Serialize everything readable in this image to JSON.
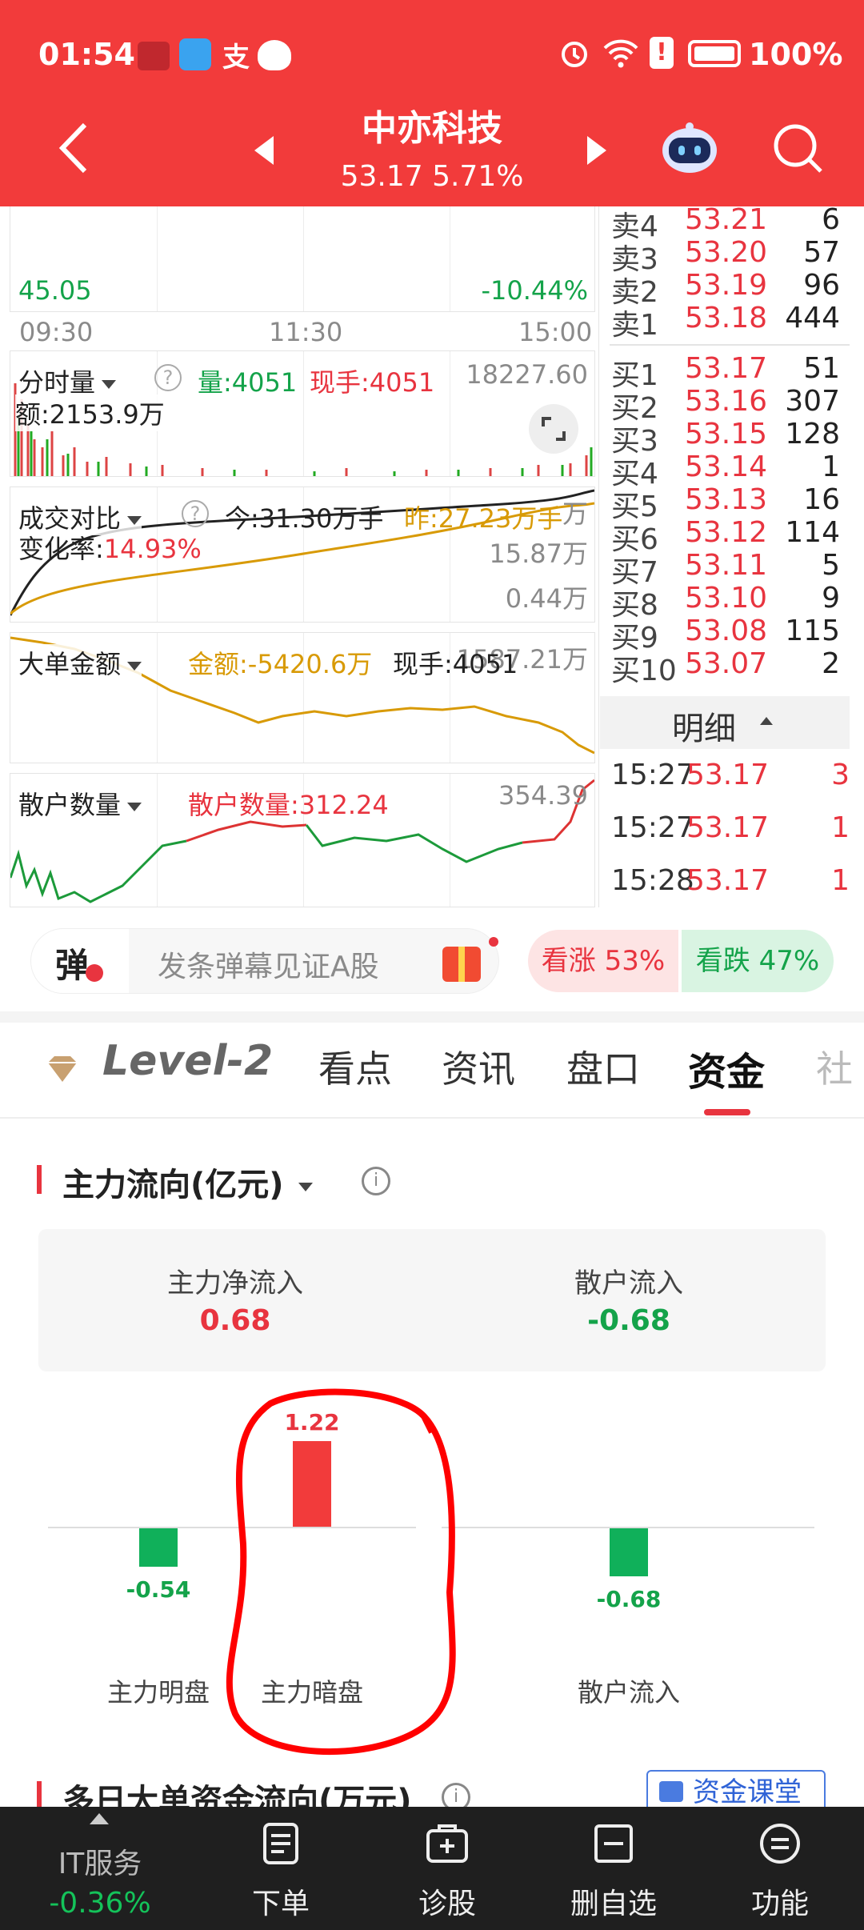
{
  "status_bar": {
    "time": "01:54",
    "battery": "100%"
  },
  "header": {
    "title": "中亦科技",
    "price_line": "53.17  5.71%"
  },
  "price_chart": {
    "low_price": "45.05",
    "low_pct": "-10.44%",
    "times": [
      "09:30",
      "11:30",
      "15:00"
    ]
  },
  "volume_panel": {
    "tab": "分时量",
    "vol": "量:4051",
    "hand": "现手:4051",
    "max": "18227.60",
    "amount": "额:2153.9万"
  },
  "compare_panel": {
    "tab": "成交对比",
    "today": "今:31.30万手",
    "yesterday": "昨:27.23万手",
    "turnover_label": "变化率:",
    "turnover_value": "14.93%",
    "axis_top": "万",
    "axis_mid": "15.87万",
    "axis_low": "0.44万"
  },
  "bigorder_panel": {
    "tab": "大单金额",
    "amount": "金额:-5420.6万",
    "hand": "现手:4051",
    "axis": "1587.21万"
  },
  "retail_panel": {
    "tab": "散户数量",
    "count": "散户数量:312.24",
    "axis": "354.39"
  },
  "order_book": {
    "asks": [
      {
        "label": "卖4",
        "price": "53.21",
        "vol": "6"
      },
      {
        "label": "卖3",
        "price": "53.20",
        "vol": "57"
      },
      {
        "label": "卖2",
        "price": "53.19",
        "vol": "96"
      },
      {
        "label": "卖1",
        "price": "53.18",
        "vol": "444"
      }
    ],
    "bids": [
      {
        "label": "买1",
        "price": "53.17",
        "vol": "51"
      },
      {
        "label": "买2",
        "price": "53.16",
        "vol": "307"
      },
      {
        "label": "买3",
        "price": "53.15",
        "vol": "128"
      },
      {
        "label": "买4",
        "price": "53.14",
        "vol": "1"
      },
      {
        "label": "买5",
        "price": "53.13",
        "vol": "16"
      },
      {
        "label": "买6",
        "price": "53.12",
        "vol": "114"
      },
      {
        "label": "买7",
        "price": "53.11",
        "vol": "5"
      },
      {
        "label": "买8",
        "price": "53.10",
        "vol": "9"
      },
      {
        "label": "买9",
        "price": "53.08",
        "vol": "115"
      },
      {
        "label": "买10",
        "price": "53.07",
        "vol": "2"
      }
    ],
    "detail_label": "明细",
    "trades": [
      {
        "time": "15:27",
        "price": "53.17",
        "vol": "3"
      },
      {
        "time": "15:27",
        "price": "53.17",
        "vol": "1"
      },
      {
        "time": "15:28",
        "price": "53.17",
        "vol": "1"
      }
    ]
  },
  "danmu": {
    "icon_text": "弹",
    "placeholder": "发条弹幕见证A股",
    "up": "看涨 53%",
    "down": "看跌 47%"
  },
  "tabs": {
    "level2": "Level-2",
    "items": [
      "看点",
      "资讯",
      "盘口",
      "资金",
      "社"
    ],
    "active": "资金"
  },
  "fund_flow": {
    "title": "主力流向(亿元)",
    "main_net_label": "主力净流入",
    "main_net_value": "0.68",
    "retail_label": "散户流入",
    "retail_value": "-0.68"
  },
  "chart_data": {
    "type": "bar",
    "categories": [
      "主力明盘",
      "主力暗盘",
      "散户流入"
    ],
    "values": [
      -0.54,
      1.22,
      -0.68
    ],
    "value_labels": [
      "-0.54",
      "1.22",
      "-0.68"
    ],
    "colors": {
      "positive": "#f23b3b",
      "negative": "#10b05a"
    }
  },
  "multi_day": {
    "title": "多日大单资金流向(万元)",
    "course_button": "资金课堂"
  },
  "bottom_nav": {
    "index_name": "IT服务",
    "index_change": "-0.36%",
    "items": [
      "下单",
      "诊股",
      "删自选",
      "功能"
    ]
  }
}
